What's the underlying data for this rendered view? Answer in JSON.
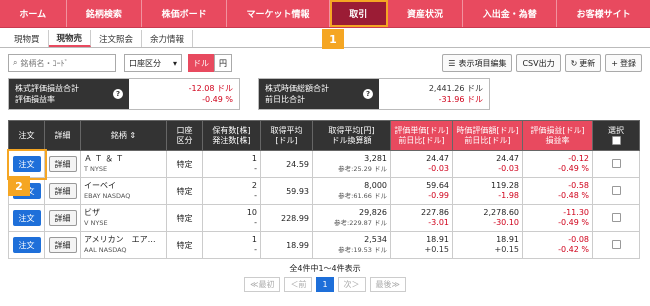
{
  "nav": {
    "items": [
      "ホーム",
      "銘柄検索",
      "株価ボード",
      "マーケット情報",
      "取引",
      "資産状況",
      "入出金・為替",
      "お客様サイト"
    ],
    "active_index": 4,
    "badge1": "1",
    "badge2": "2"
  },
  "subtabs": [
    "現物買",
    "現物売",
    "注文照会",
    "余力情報"
  ],
  "toolbar": {
    "search_placeholder": "銘柄名・ｺｰﾄﾞ",
    "select_value": "口座区分",
    "currency_dollar": "ドル",
    "currency_yen": "円",
    "btn_columns": "表示項目編集",
    "btn_csv": "CSV出力",
    "btn_refresh": "更新",
    "btn_register": "登録"
  },
  "summary": {
    "left_label1": "株式評価損益合計",
    "left_label2": "評価損益率",
    "left_value1": "-12.08 ドル",
    "left_value2": "-0.49 %",
    "right_label1": "株式時価総額合計",
    "right_label2": "前日比合計",
    "right_value1": "2,441.26 ドル",
    "right_value2": "-31.96 ドル"
  },
  "table": {
    "headers": {
      "order": "注文",
      "detail": "詳細",
      "name": "銘柄",
      "account1": "口座",
      "account2": "区分",
      "qty1": "保有数[株]",
      "qty2": "発注数[株]",
      "avg1": "取得平均",
      "avg2": "[ドル]",
      "cost1": "取得平均[円]",
      "cost2": "ドル換算額",
      "unit1": "評価単価[ドル]",
      "unit2": "前日比[ドル]",
      "mv1": "時価評価額[ドル]",
      "mv2": "前日比[ドル]",
      "pl1": "評価損益[ドル]",
      "pl2": "損益率",
      "select": "選択"
    },
    "order_label": "注文",
    "detail_label": "詳細",
    "rows": [
      {
        "name": "Ａ Ｔ ＆ Ｔ",
        "ticker": "T NYSE",
        "account": "特定",
        "qty": "1",
        "order_qty": "-",
        "avg": "24.59",
        "cost": "3,281",
        "cost_ref": "参考:25.29 ドル",
        "unit": "24.47",
        "unit_chg": "-0.03",
        "mv": "24.47",
        "mv_chg": "-0.03",
        "pl": "-0.12",
        "pl_rate": "-0.49 %"
      },
      {
        "name": "イーベイ",
        "ticker": "EBAY NASDAQ",
        "account": "特定",
        "qty": "2",
        "order_qty": "-",
        "avg": "59.93",
        "cost": "8,000",
        "cost_ref": "参考:61.66 ドル",
        "unit": "59.64",
        "unit_chg": "-0.99",
        "mv": "119.28",
        "mv_chg": "-1.98",
        "pl": "-0.58",
        "pl_rate": "-0.48 %"
      },
      {
        "name": "ビザ",
        "ticker": "V NYSE",
        "account": "特定",
        "qty": "10",
        "order_qty": "-",
        "avg": "228.99",
        "cost": "29,826",
        "cost_ref": "参考:229.87 ドル",
        "unit": "227.86",
        "unit_chg": "-3.01",
        "mv": "2,278.60",
        "mv_chg": "-30.10",
        "pl": "-11.30",
        "pl_rate": "-0.49 %"
      },
      {
        "name": "アメリカン　エア…",
        "ticker": "AAL NASDAQ",
        "account": "特定",
        "qty": "1",
        "order_qty": "-",
        "avg": "18.99",
        "cost": "2,534",
        "cost_ref": "参考:19.53 ドル",
        "unit": "18.91",
        "unit_chg": "+0.15",
        "mv": "18.91",
        "mv_chg": "+0.15",
        "pl": "-0.08",
        "pl_rate": "-0.42 %"
      }
    ]
  },
  "pagination": {
    "info": "全4件中1〜4件表示",
    "first": "≪最初",
    "prev": "＜前",
    "current": "1",
    "next": "次＞",
    "last": "最後≫"
  }
}
